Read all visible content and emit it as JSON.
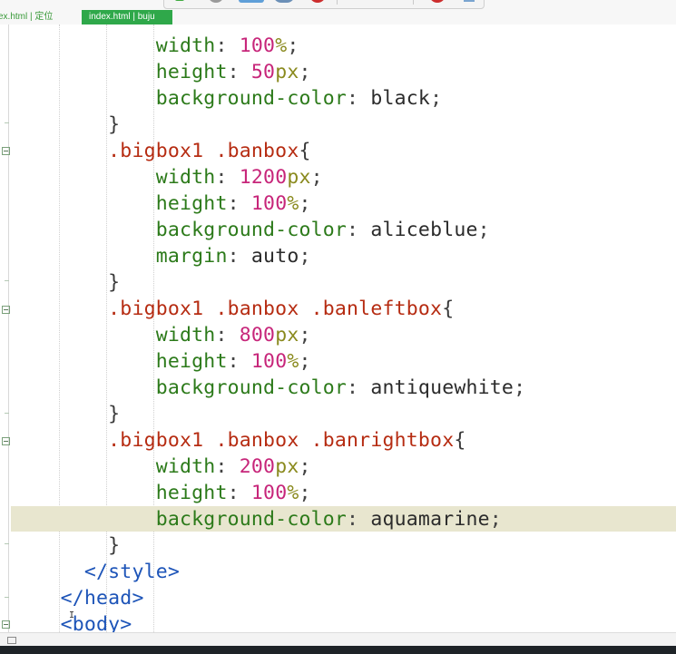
{
  "tabs": [
    {
      "label": "ex.html | 定位",
      "active": false
    },
    {
      "label": "index.html | buju",
      "active": true
    }
  ],
  "toolbar": {
    "icons": [
      "back-icon",
      "clock-icon",
      "preview-icon",
      "browser-icon",
      "stop-icon",
      "align-top-icon",
      "align-bottom-icon",
      "record-icon",
      "pin-icon"
    ]
  },
  "colors": {
    "property": "#2c7a1a",
    "number": "#c7267a",
    "unit": "#8a8a1e",
    "selector": "#b62c12",
    "tag": "#1d54b8",
    "current_line": "#e8e6cf",
    "active_tab": "#2fa84a"
  },
  "editor": {
    "lines": [
      {
        "indent": "            ",
        "prop": "width",
        "num": "100",
        "unit": "%",
        "end": ";"
      },
      {
        "indent": "            ",
        "prop": "height",
        "num": "50",
        "unit": "px",
        "end": ";"
      },
      {
        "indent": "            ",
        "prop": "background-color",
        "value": "black",
        "end": ";"
      },
      {
        "indent": "        ",
        "brace": "}"
      },
      {
        "indent": "        ",
        "selector": ".bigbox1 .banbox",
        "brace": "{"
      },
      {
        "indent": "            ",
        "prop": "width",
        "num": "1200",
        "unit": "px",
        "end": ";"
      },
      {
        "indent": "            ",
        "prop": "height",
        "num": "100",
        "unit": "%",
        "end": ";"
      },
      {
        "indent": "            ",
        "prop": "background-color",
        "value": "aliceblue",
        "end": ";"
      },
      {
        "indent": "            ",
        "prop": "margin",
        "value": "auto",
        "end": ";"
      },
      {
        "indent": "        ",
        "brace": "}"
      },
      {
        "indent": "        ",
        "selector": ".bigbox1 .banbox .banleftbox",
        "brace": "{"
      },
      {
        "indent": "            ",
        "prop": "width",
        "num": "800",
        "unit": "px",
        "end": ";"
      },
      {
        "indent": "            ",
        "prop": "height",
        "num": "100",
        "unit": "%",
        "end": ";"
      },
      {
        "indent": "            ",
        "prop": "background-color",
        "value": "antiquewhite",
        "end": ";"
      },
      {
        "indent": "        ",
        "brace": "}"
      },
      {
        "indent": "        ",
        "selector": ".bigbox1 .banbox .banrightbox",
        "brace": "{"
      },
      {
        "indent": "            ",
        "prop": "width",
        "num": "200",
        "unit": "px",
        "end": ";"
      },
      {
        "indent": "            ",
        "prop": "height",
        "num": "100",
        "unit": "%",
        "end": ";"
      },
      {
        "indent": "            ",
        "prop": "background-color",
        "value": "aquamarine",
        "end": ";"
      },
      {
        "indent": "        ",
        "brace": "}"
      },
      {
        "indent": "      ",
        "tag": "</style>"
      },
      {
        "indent": "    ",
        "tag": "</head>"
      },
      {
        "indent": "    ",
        "tag": "<body>"
      }
    ]
  }
}
